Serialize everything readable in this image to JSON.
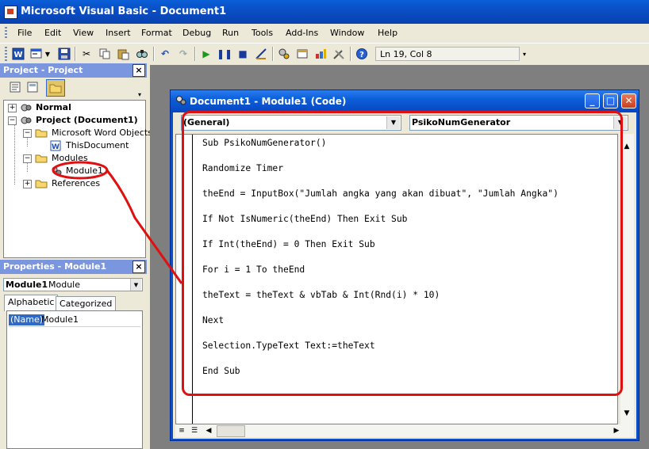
{
  "app": {
    "title": "Microsoft Visual Basic - Document1",
    "icon": "vba-app-icon"
  },
  "menu": [
    "File",
    "Edit",
    "View",
    "Insert",
    "Format",
    "Debug",
    "Run",
    "Tools",
    "Add-Ins",
    "Window",
    "Help"
  ],
  "toolbar": {
    "position": "Ln 19, Col 8",
    "icons": [
      "word-icon",
      "insert-userform-icon",
      "save-icon",
      "cut-icon",
      "copy-icon",
      "paste-icon",
      "find-icon",
      "undo-icon",
      "redo-icon",
      "run-icon",
      "break-icon",
      "reset-icon",
      "design-mode-icon",
      "project-explorer-icon",
      "properties-icon",
      "object-browser-icon",
      "toolbox-icon",
      "help-icon"
    ]
  },
  "project_pane": {
    "title": "Project - Project",
    "tree": [
      {
        "label": "Normal",
        "bold": true,
        "expand": "+"
      },
      {
        "label": "Project (Document1)",
        "bold": true,
        "expand": "−"
      },
      {
        "label": "Microsoft Word Objects",
        "expand": "−"
      },
      {
        "label": "ThisDocument"
      },
      {
        "label": "Modules",
        "expand": "−"
      },
      {
        "label": "Module1"
      },
      {
        "label": "References",
        "expand": "+"
      }
    ]
  },
  "properties_pane": {
    "title": "Properties - Module1",
    "object": "Module1",
    "object_type": "Module",
    "tabs": [
      "Alphabetic",
      "Categorized"
    ],
    "row_name": "(Name)",
    "row_value": "Module1"
  },
  "code_window": {
    "title": "Document1 - Module1 (Code)",
    "object_combo": "(General)",
    "procedure_combo": "PsikoNumGenerator",
    "lines": [
      "Sub PsikoNumGenerator()",
      "Randomize Timer",
      "theEnd = InputBox(\"Jumlah angka yang akan dibuat\", \"Jumlah Angka\")",
      "If Not IsNumeric(theEnd) Then Exit Sub",
      "If Int(theEnd) = 0 Then Exit Sub",
      "For i = 1 To theEnd",
      "theText = theText & vbTab & Int(Rnd(i) * 10)",
      "Next",
      "Selection.TypeText Text:=theText",
      "End Sub"
    ]
  },
  "colors": {
    "title_bar": "#0a4fc6",
    "annotation": "#e01010",
    "pane_header": "#7a96df"
  }
}
